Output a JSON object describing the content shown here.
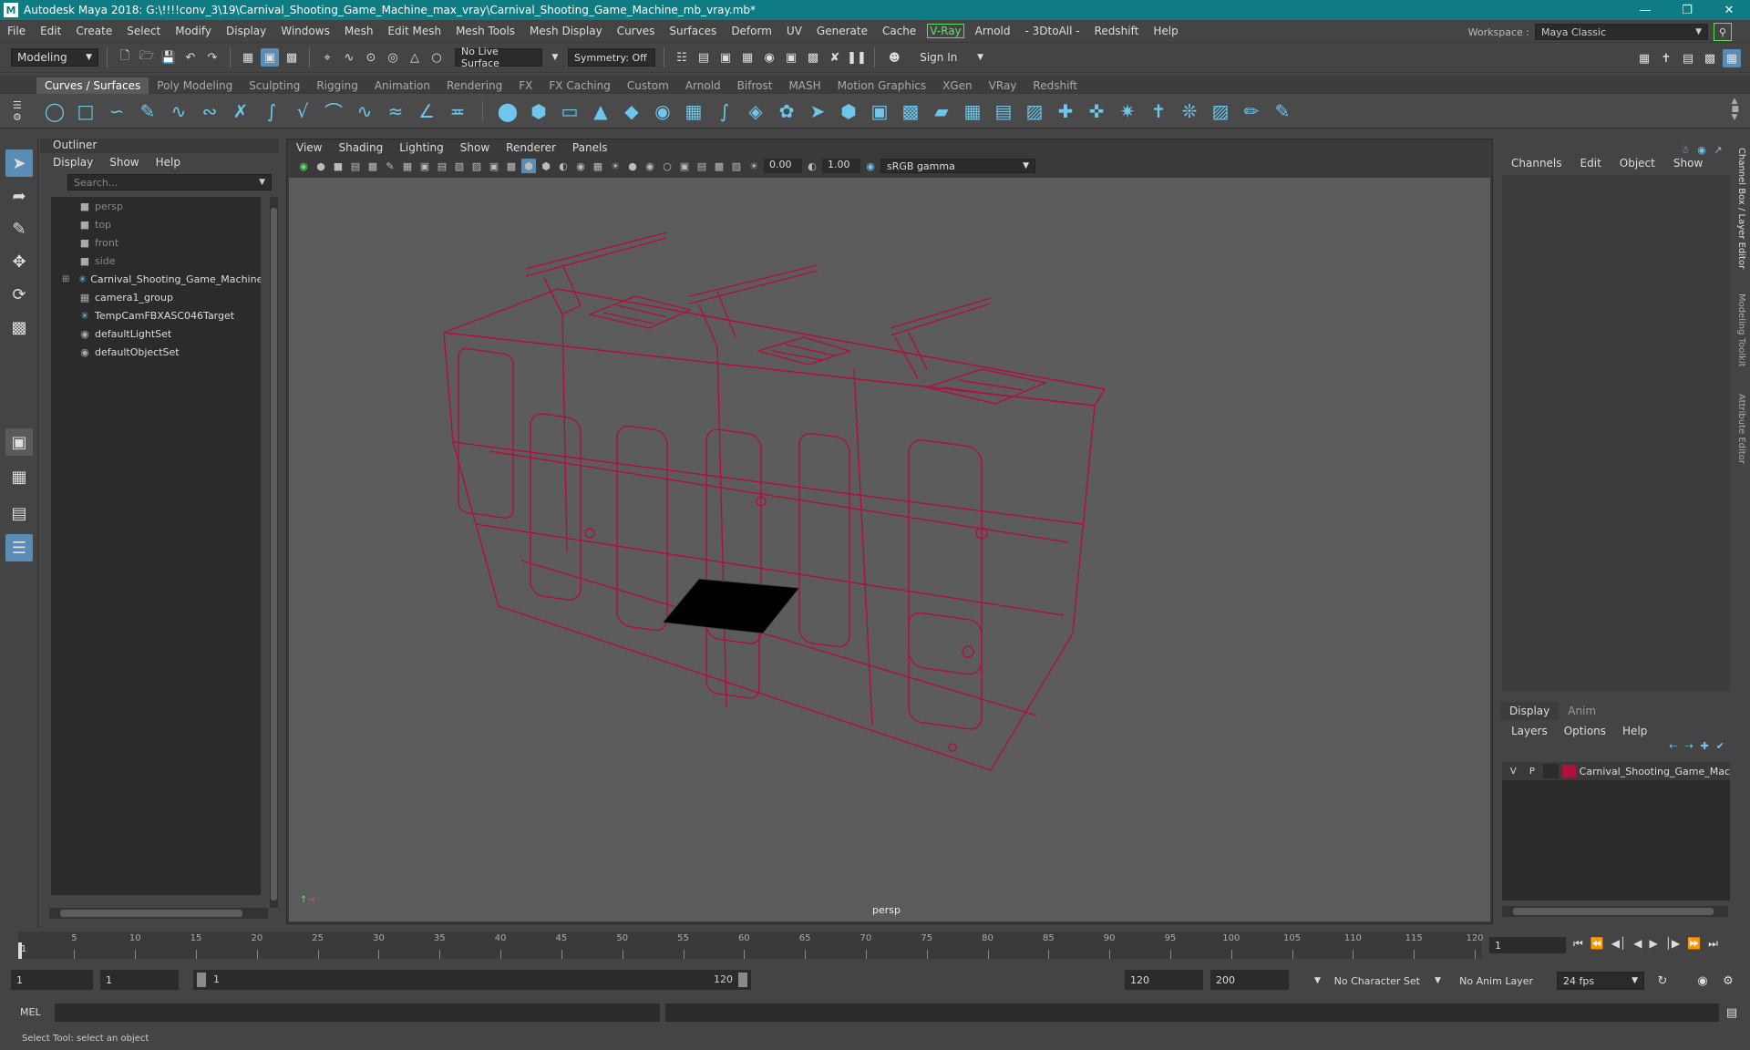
{
  "window": {
    "title": "Autodesk Maya 2018: G:\\!!!!conv_3\\19\\Carnival_Shooting_Game_Machine_max_vray\\Carnival_Shooting_Game_Machine_mb_vray.mb*",
    "logo_letter": "M"
  },
  "menu": {
    "items": [
      "File",
      "Edit",
      "Create",
      "Select",
      "Modify",
      "Display",
      "Windows",
      "Mesh",
      "Edit Mesh",
      "Mesh Tools",
      "Mesh Display",
      "Curves",
      "Surfaces",
      "Deform",
      "UV",
      "Generate",
      "Cache",
      "V-Ray",
      "Arnold",
      "- 3DtoAll -",
      "Redshift",
      "Help"
    ],
    "workspace_label": "Workspace :",
    "workspace_value": "Maya Classic"
  },
  "status": {
    "mode": "Modeling",
    "live_surface": "No Live Surface",
    "symmetry": "Symmetry: Off",
    "sign_in": "Sign In"
  },
  "shelf": {
    "tabs": [
      "Curves / Surfaces",
      "Poly Modeling",
      "Sculpting",
      "Rigging",
      "Animation",
      "Rendering",
      "FX",
      "FX Caching",
      "Custom",
      "Arnold",
      "Bifrost",
      "MASH",
      "Motion Graphics",
      "XGen",
      "VRay",
      "Redshift"
    ],
    "active_tab": 0
  },
  "outliner": {
    "title": "Outliner",
    "menus": [
      "Display",
      "Show",
      "Help"
    ],
    "search_placeholder": "Search...",
    "items": [
      {
        "label": "persp",
        "icon": "camera-icon",
        "dim": true
      },
      {
        "label": "top",
        "icon": "camera-icon",
        "dim": true
      },
      {
        "label": "front",
        "icon": "camera-icon",
        "dim": true
      },
      {
        "label": "side",
        "icon": "camera-icon",
        "dim": true
      },
      {
        "label": "Carnival_Shooting_Game_Machine_n",
        "icon": "transform-icon",
        "dim": false,
        "expandable": true
      },
      {
        "label": "camera1_group",
        "icon": "group-icon",
        "dim": false
      },
      {
        "label": "TempCamFBXASC046Target",
        "icon": "transform-icon",
        "dim": false
      },
      {
        "label": "defaultLightSet",
        "icon": "set-icon",
        "dim": false
      },
      {
        "label": "defaultObjectSet",
        "icon": "set-icon",
        "dim": false
      }
    ]
  },
  "viewport": {
    "menus": [
      "View",
      "Shading",
      "Lighting",
      "Show",
      "Renderer",
      "Panels"
    ],
    "exposure": "0.00",
    "gamma": "1.00",
    "color_space": "sRGB gamma",
    "camera_label": "persp",
    "wire_color": "#b0103e"
  },
  "channelbox": {
    "menus": [
      "Channels",
      "Edit",
      "Object",
      "Show"
    ],
    "layer_tabs": [
      "Display",
      "Anim"
    ],
    "layer_menus": [
      "Layers",
      "Options",
      "Help"
    ],
    "layer": {
      "v": "V",
      "p": "P",
      "name": "Carnival_Shooting_Game_Mac",
      "color": "#b0103e"
    },
    "side_tabs": [
      "Channel Box / Layer Editor",
      "Modeling Toolkit",
      "Attribute Editor"
    ]
  },
  "timeline": {
    "ticks": [
      "5",
      "10",
      "15",
      "20",
      "25",
      "30",
      "35",
      "40",
      "45",
      "50",
      "55",
      "60",
      "65",
      "70",
      "75",
      "80",
      "85",
      "90",
      "95",
      "100",
      "105",
      "110",
      "115",
      "120"
    ],
    "start_marker": "1",
    "current_frame": "1"
  },
  "range": {
    "start": "1",
    "playback_start": "1",
    "range_start": "1",
    "range_end": "120",
    "playback_end": "120",
    "end": "200",
    "character_set": "No Character Set",
    "anim_layer": "No Anim Layer",
    "fps": "24 fps"
  },
  "command": {
    "label": "MEL",
    "help": "Select Tool: select an object"
  }
}
